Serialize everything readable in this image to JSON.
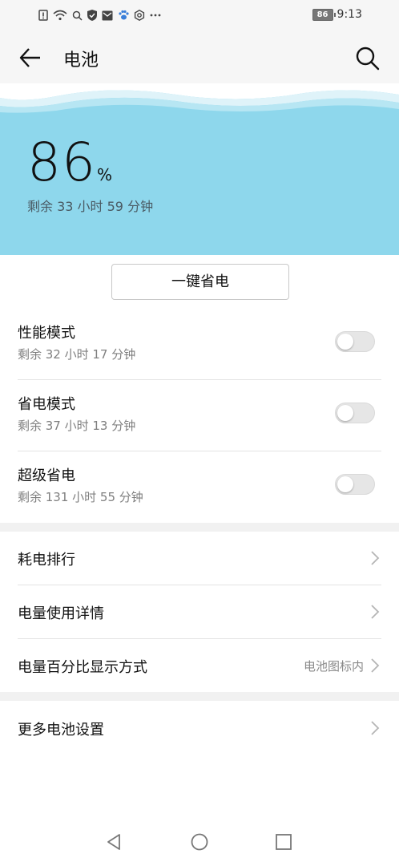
{
  "status_bar": {
    "battery_level": "86",
    "time": "9:13",
    "icons": [
      "alert-icon",
      "wifi-icon",
      "search-icon",
      "shield-icon",
      "mail-icon",
      "paw-icon",
      "settings-icon",
      "more-icon"
    ]
  },
  "app_bar": {
    "title": "电池"
  },
  "summary": {
    "percent": "86",
    "percent_sign": "%",
    "remaining": "剩余 33 小时 59 分钟"
  },
  "one_key_save_label": "一键省电",
  "modes": [
    {
      "title": "性能模式",
      "remaining": "剩余 32 小时 17 分钟",
      "enabled": false
    },
    {
      "title": "省电模式",
      "remaining": "剩余 37 小时 13 分钟",
      "enabled": false
    },
    {
      "title": "超级省电",
      "remaining": "剩余 131 小时 55 分钟",
      "enabled": false
    }
  ],
  "nav_items": [
    {
      "title": "耗电排行",
      "value": ""
    },
    {
      "title": "电量使用详情",
      "value": ""
    },
    {
      "title": "电量百分比显示方式",
      "value": "电池图标内"
    }
  ],
  "more_settings_label": "更多电池设置",
  "colors": {
    "hero_bg": "#8ed7ec",
    "switch_off": "#e6e6e6"
  }
}
